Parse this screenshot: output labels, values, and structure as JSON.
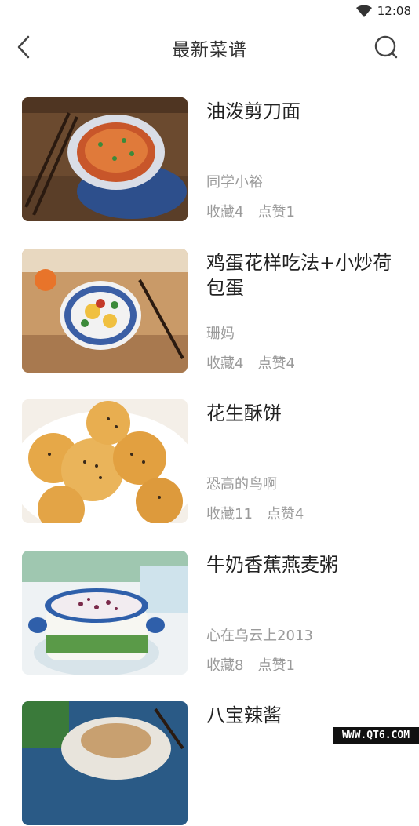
{
  "status_bar": {
    "time": "12:08"
  },
  "header": {
    "title": "最新菜谱"
  },
  "recipes": [
    {
      "title": "油泼剪刀面",
      "author": "同学小裕",
      "favorites": "收藏4",
      "likes": "点赞1"
    },
    {
      "title": "鸡蛋花样吃法+小炒荷包蛋",
      "author": "珊妈",
      "favorites": "收藏4",
      "likes": "点赞4"
    },
    {
      "title": "花生酥饼",
      "author": "恐高的鸟啊",
      "favorites": "收藏11",
      "likes": "点赞4"
    },
    {
      "title": "牛奶香蕉燕麦粥",
      "author": "心在乌云上2013",
      "favorites": "收藏8",
      "likes": "点赞1"
    },
    {
      "title": "八宝辣酱",
      "author": "",
      "favorites": "",
      "likes": ""
    }
  ],
  "watermark": "WWW.QT6.COM"
}
